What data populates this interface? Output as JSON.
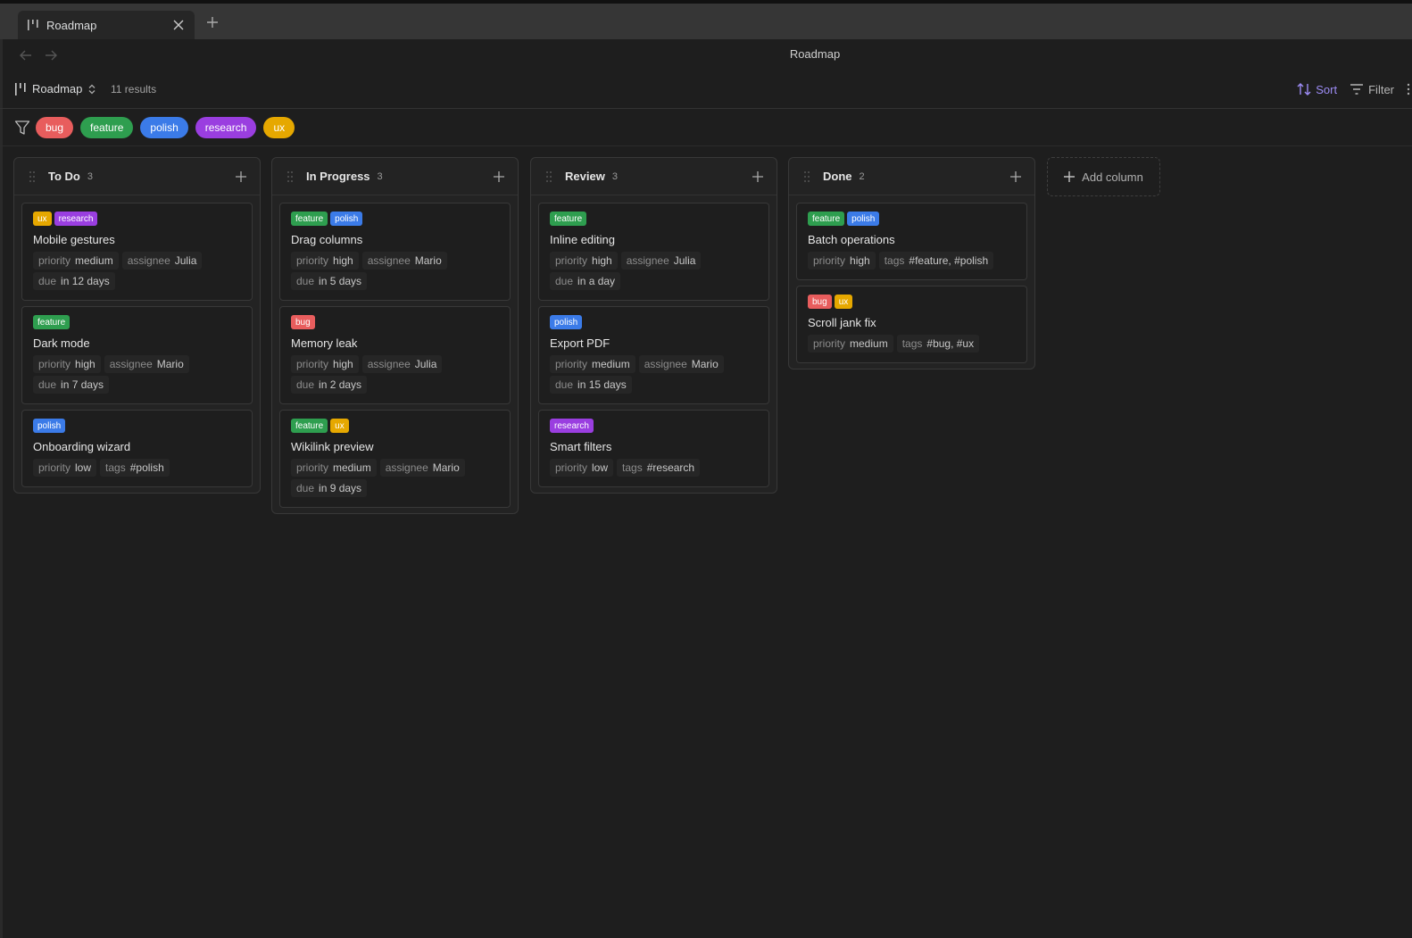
{
  "tab": {
    "title": "Roadmap",
    "icon": "kanban-icon"
  },
  "nav": {
    "title": "Roadmap"
  },
  "toolbar": {
    "view_name": "Roadmap",
    "results": "11 results",
    "sort_label": "Sort",
    "filter_label": "Filter"
  },
  "filters": [
    {
      "label": "bug",
      "color": "#e85d5d"
    },
    {
      "label": "feature",
      "color": "#2e9e4f"
    },
    {
      "label": "polish",
      "color": "#3b7be8"
    },
    {
      "label": "research",
      "color": "#9a3ee0"
    },
    {
      "label": "ux",
      "color": "#e6a800"
    }
  ],
  "tag_colors": {
    "bug": "#e85d5d",
    "feature": "#2e9e4f",
    "polish": "#3b7be8",
    "research": "#9a3ee0",
    "ux": "#e6a800"
  },
  "columns": [
    {
      "title": "To Do",
      "count": "3",
      "cards": [
        {
          "tags": [
            "ux",
            "research"
          ],
          "title": "Mobile gestures",
          "props": [
            {
              "k": "priority",
              "v": "medium"
            },
            {
              "k": "assignee",
              "v": "Julia"
            },
            {
              "k": "due",
              "v": "in 12 days"
            }
          ]
        },
        {
          "tags": [
            "feature"
          ],
          "title": "Dark mode",
          "props": [
            {
              "k": "priority",
              "v": "high"
            },
            {
              "k": "assignee",
              "v": "Mario"
            },
            {
              "k": "due",
              "v": "in 7 days"
            }
          ]
        },
        {
          "tags": [
            "polish"
          ],
          "title": "Onboarding wizard",
          "props": [
            {
              "k": "priority",
              "v": "low"
            },
            {
              "k": "tags",
              "v": "#polish"
            }
          ]
        }
      ]
    },
    {
      "title": "In Progress",
      "count": "3",
      "cards": [
        {
          "tags": [
            "feature",
            "polish"
          ],
          "title": "Drag columns",
          "props": [
            {
              "k": "priority",
              "v": "high"
            },
            {
              "k": "assignee",
              "v": "Mario"
            },
            {
              "k": "due",
              "v": "in 5 days"
            }
          ]
        },
        {
          "tags": [
            "bug"
          ],
          "title": "Memory leak",
          "props": [
            {
              "k": "priority",
              "v": "high"
            },
            {
              "k": "assignee",
              "v": "Julia"
            },
            {
              "k": "due",
              "v": "in 2 days"
            }
          ]
        },
        {
          "tags": [
            "feature",
            "ux"
          ],
          "title": "Wikilink preview",
          "props": [
            {
              "k": "priority",
              "v": "medium"
            },
            {
              "k": "assignee",
              "v": "Mario"
            },
            {
              "k": "due",
              "v": "in 9 days"
            }
          ]
        }
      ]
    },
    {
      "title": "Review",
      "count": "3",
      "cards": [
        {
          "tags": [
            "feature"
          ],
          "title": "Inline editing",
          "props": [
            {
              "k": "priority",
              "v": "high"
            },
            {
              "k": "assignee",
              "v": "Julia"
            },
            {
              "k": "due",
              "v": "in a day"
            }
          ]
        },
        {
          "tags": [
            "polish"
          ],
          "title": "Export PDF",
          "props": [
            {
              "k": "priority",
              "v": "medium"
            },
            {
              "k": "assignee",
              "v": "Mario"
            },
            {
              "k": "due",
              "v": "in 15 days"
            }
          ]
        },
        {
          "tags": [
            "research"
          ],
          "title": "Smart filters",
          "props": [
            {
              "k": "priority",
              "v": "low"
            },
            {
              "k": "tags",
              "v": "#research"
            }
          ]
        }
      ]
    },
    {
      "title": "Done",
      "count": "2",
      "cards": [
        {
          "tags": [
            "feature",
            "polish"
          ],
          "title": "Batch operations",
          "props": [
            {
              "k": "priority",
              "v": "high"
            },
            {
              "k": "tags",
              "v": "#feature, #polish"
            }
          ]
        },
        {
          "tags": [
            "bug",
            "ux"
          ],
          "title": "Scroll jank fix",
          "props": [
            {
              "k": "priority",
              "v": "medium"
            },
            {
              "k": "tags",
              "v": "#bug, #ux"
            }
          ]
        }
      ]
    }
  ],
  "add_column_label": "Add column"
}
